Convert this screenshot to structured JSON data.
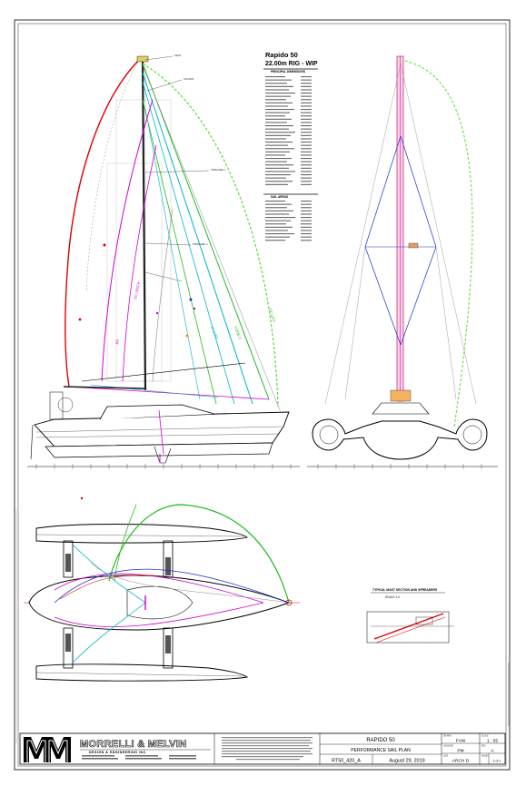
{
  "title_block": {
    "firm_name": "MORRELLI & MELVIN",
    "firm_subtitle": "DESIGN & ENGINEERING INC",
    "project": "RAPIDO 50",
    "drawing_title": "PERFORMANCE SAIL PLAN",
    "drawing_number": "RT50_420_A",
    "date": "August 29, 2019",
    "scale_label": "SCALE",
    "scale": "1 : 55",
    "drawn_label": "DRAWN",
    "drawn_by": "FVW",
    "checked_label": "CHECKED",
    "checked_by": "PM",
    "rev_label": "REV",
    "revision": "A",
    "size_label": "SIZE",
    "sheet_size": "ARCH D",
    "sheet_label": "SHEET",
    "sheet": "1 of 1"
  },
  "spec_table": {
    "title": "Rapido 50",
    "subtitle": "22.00m RIG - WIP",
    "dimensions_heading": "PRINCIPAL DIMENSIONS",
    "sail_areas_heading": "SAIL AREAS"
  },
  "mast_section": {
    "title": "TYPICAL MAST SECTION AND SPREADERS",
    "scale": "SCALE 1:4"
  },
  "sail_labels": {
    "code0": "CODE 0",
    "g0_leech": "G0 LEECH",
    "jib": "JIB",
    "j1": "J1 LUFF",
    "luff": "A2 LUFF"
  },
  "colors": {
    "frame": "#000000",
    "rig_cyan": "#00b5c8",
    "rig_green": "#22bb22",
    "rig_magenta": "#d000d0",
    "rig_red": "#dd0000",
    "rig_blue": "#1a2fd0",
    "code0_green": "#55dd33"
  }
}
